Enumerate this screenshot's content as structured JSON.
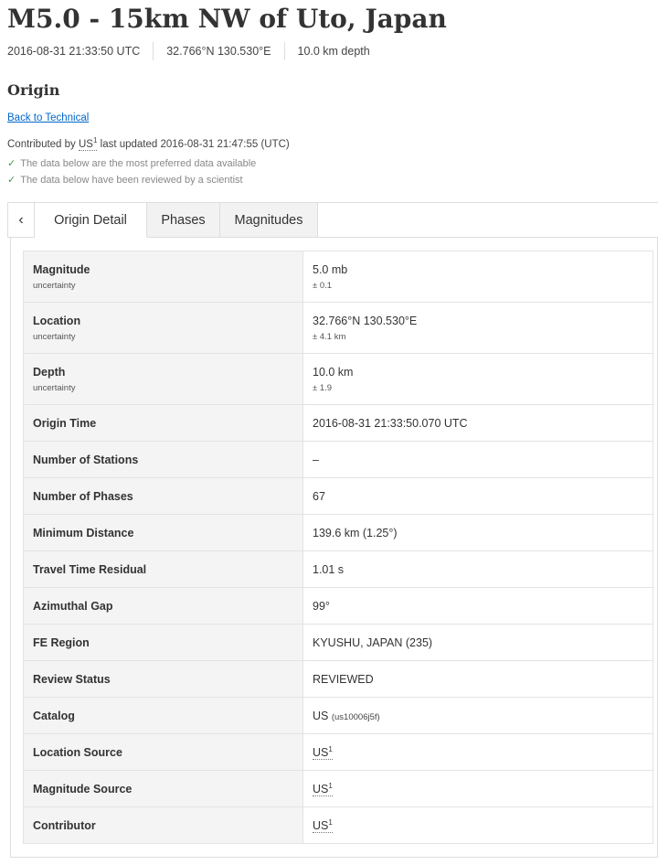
{
  "header": {
    "title": "M5.0 - 15km NW of Uto, Japan",
    "time": "2016-08-31 21:33:50 UTC",
    "coordinates": "32.766°N  130.530°E",
    "depth": "10.0 km depth"
  },
  "origin": {
    "section_title": "Origin",
    "back_link": "Back to Technical",
    "contributed_prefix": "Contributed by",
    "contributed_source": "US",
    "contributed_source_sup": "1",
    "contributed_suffix": " last updated 2016-08-31 21:47:55 (UTC)",
    "checks": [
      "The data below are the most preferred data available",
      "The data below have been reviewed by a scientist"
    ]
  },
  "tabs": {
    "back_icon": "chevron-left-icon",
    "back_glyph": "‹",
    "items": [
      "Origin Detail",
      "Phases",
      "Magnitudes"
    ],
    "active": "Origin Detail"
  },
  "details": {
    "magnitude": {
      "label": "Magnitude",
      "sublabel": "uncertainty",
      "value": "5.0 mb",
      "subvalue": "± 0.1"
    },
    "location": {
      "label": "Location",
      "sublabel": "uncertainty",
      "value": "32.766°N 130.530°E",
      "subvalue": "± 4.1 km"
    },
    "depth": {
      "label": "Depth",
      "sublabel": "uncertainty",
      "value": "10.0 km",
      "subvalue": "± 1.9"
    },
    "origin_time": {
      "label": "Origin Time",
      "value": "2016-08-31 21:33:50.070 UTC"
    },
    "num_stations": {
      "label": "Number of Stations",
      "value": "–"
    },
    "num_phases": {
      "label": "Number of Phases",
      "value": "67"
    },
    "min_distance": {
      "label": "Minimum Distance",
      "value": "139.6 km (1.25°)"
    },
    "travel_time_residual": {
      "label": "Travel Time Residual",
      "value": "1.01 s"
    },
    "azimuthal_gap": {
      "label": "Azimuthal Gap",
      "value": "99°"
    },
    "fe_region": {
      "label": "FE Region",
      "value": "KYUSHU, JAPAN (235)"
    },
    "review_status": {
      "label": "Review Status",
      "value": "REVIEWED"
    },
    "catalog": {
      "label": "Catalog",
      "value": "US",
      "subvalue": "(us10006j5f)"
    },
    "location_source": {
      "label": "Location Source",
      "value": "US",
      "sup": "1"
    },
    "magnitude_source": {
      "label": "Magnitude Source",
      "value": "US",
      "sup": "1"
    },
    "contributor": {
      "label": "Contributor",
      "value": "US",
      "sup": "1"
    }
  }
}
